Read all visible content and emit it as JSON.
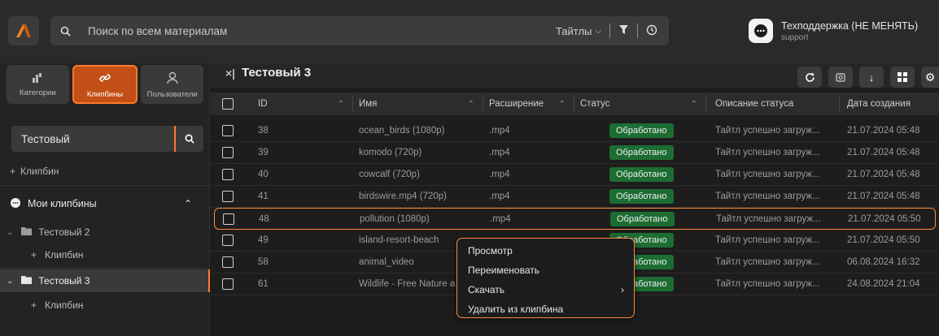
{
  "colors": {
    "accent": "#ff7a2b",
    "status_ok": "#1d6d33",
    "logo_orange": "#ff7a2b"
  },
  "topbar": {
    "search_placeholder": "Поиск по всем материалам",
    "filter_label": "Тайтлы",
    "support_name": "Техподдержка (НЕ МЕНЯТЬ)",
    "support_sub": "support"
  },
  "sidebar": {
    "tabs": [
      {
        "label": "Категории",
        "icon": "category-icon"
      },
      {
        "label": "Клипбины",
        "icon": "link-icon"
      },
      {
        "label": "Пользователи",
        "icon": "user-icon"
      }
    ],
    "search_value": "Тестовый",
    "add_clipbin": "Клипбин",
    "my_clipbins": "Мои клипбины",
    "tree": [
      {
        "label": "Тестовый 2",
        "child": "Клипбин"
      },
      {
        "label": "Тестовый 3",
        "child": "Клипбин"
      }
    ]
  },
  "main": {
    "title": "Тестовый 3",
    "columns": [
      "ID",
      "Имя",
      "Расширение",
      "Статус",
      "Описание статуса",
      "Дата создания"
    ],
    "rows": [
      {
        "id": "38",
        "name": "ocean_birds (1080p)",
        "ext": ".mp4",
        "status": "Обработано",
        "desc": "Тайтл успешно загруж...",
        "date": "21.07.2024 05:48"
      },
      {
        "id": "39",
        "name": "komodo (720p)",
        "ext": ".mp4",
        "status": "Обработано",
        "desc": "Тайтл успешно загруж...",
        "date": "21.07.2024 05:48"
      },
      {
        "id": "40",
        "name": "cowcalf (720p)",
        "ext": ".mp4",
        "status": "Обработано",
        "desc": "Тайтл успешно загруж...",
        "date": "21.07.2024 05:48"
      },
      {
        "id": "41",
        "name": "birdswire.mp4 (720p)",
        "ext": ".mp4",
        "status": "Обработано",
        "desc": "Тайтл успешно загруж...",
        "date": "21.07.2024 05:48"
      },
      {
        "id": "48",
        "name": "pollution (1080p)",
        "ext": ".mp4",
        "status": "Обработано",
        "desc": "Тайтл успешно загруж...",
        "date": "21.07.2024 05:50"
      },
      {
        "id": "49",
        "name": "island-resort-beach",
        "ext": "",
        "status": "Обработано",
        "desc": "Тайтл успешно загруж...",
        "date": "21.07.2024 05:50"
      },
      {
        "id": "58",
        "name": "animal_video",
        "ext": "",
        "status": "Обработано",
        "desc": "Тайтл успешно загруж...",
        "date": "06.08.2024 16:32"
      },
      {
        "id": "61",
        "name": "Wildlife - Free Nature a",
        "ext": "",
        "status": "Обработано",
        "desc": "Тайтл успешно загруж...",
        "date": "24.08.2024 21:04"
      }
    ]
  },
  "context_menu": {
    "items": [
      "Просмотр",
      "Переименовать",
      "Скачать",
      "Удалить из клипбина"
    ]
  }
}
